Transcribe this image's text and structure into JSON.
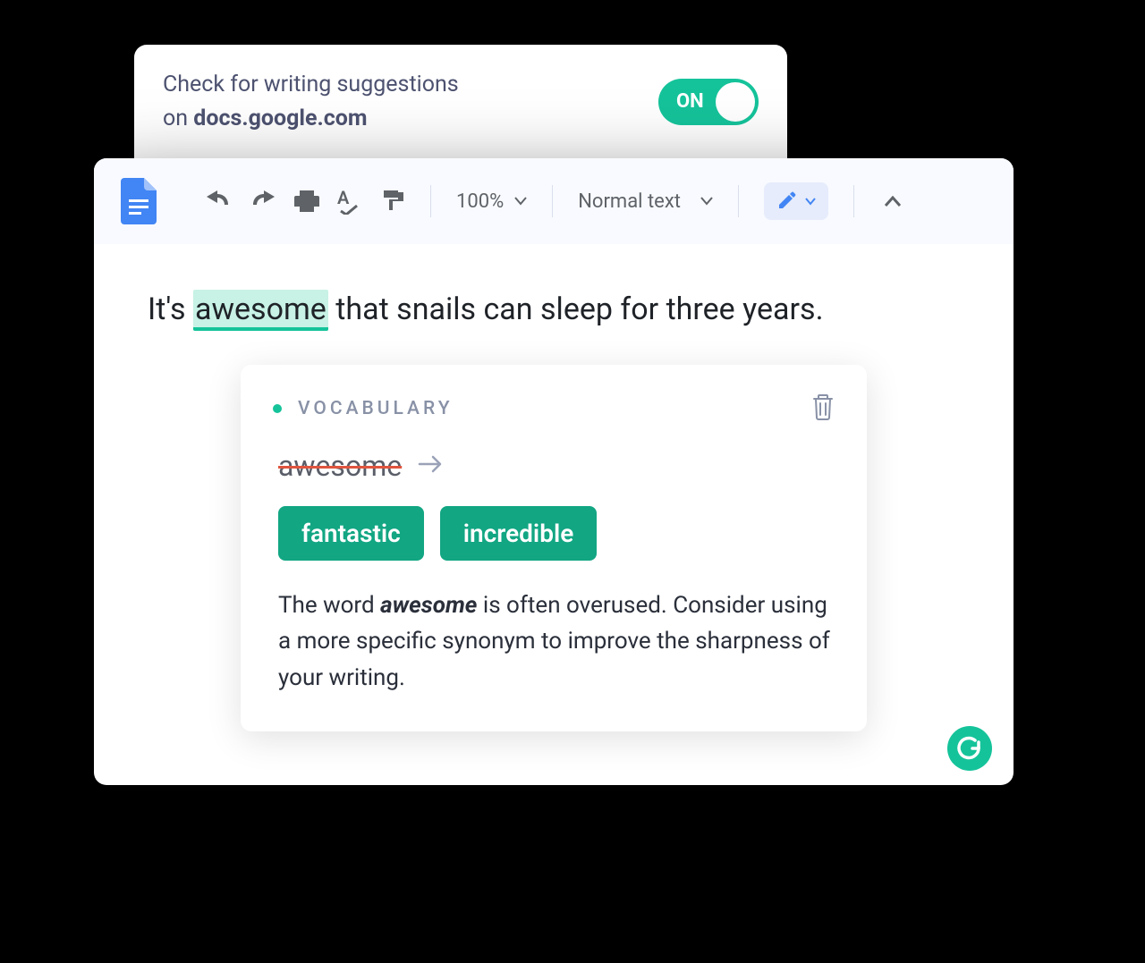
{
  "extension_panel": {
    "text_line1": "Check for writing suggestions",
    "text_line2_prefix": "on ",
    "domain": "docs.google.com",
    "toggle_label": "ON",
    "toggle_state": true
  },
  "toolbar": {
    "zoom_level": "100%",
    "text_style": "Normal text"
  },
  "document": {
    "sentence_prefix": "It's ",
    "highlighted_word": "awesome",
    "sentence_suffix": " that snails can sleep for three years."
  },
  "card": {
    "category": "VOCABULARY",
    "strike_word": "awesome",
    "suggestions": [
      "fantastic",
      "incredible"
    ],
    "desc_prefix": "The word ",
    "desc_bold": "awesome",
    "desc_suffix": " is often overused. Consider using a more specific synonym to improve the sharpness of your writing."
  },
  "colors": {
    "accent": "#15c39a",
    "docs_blue": "#4285f4"
  }
}
